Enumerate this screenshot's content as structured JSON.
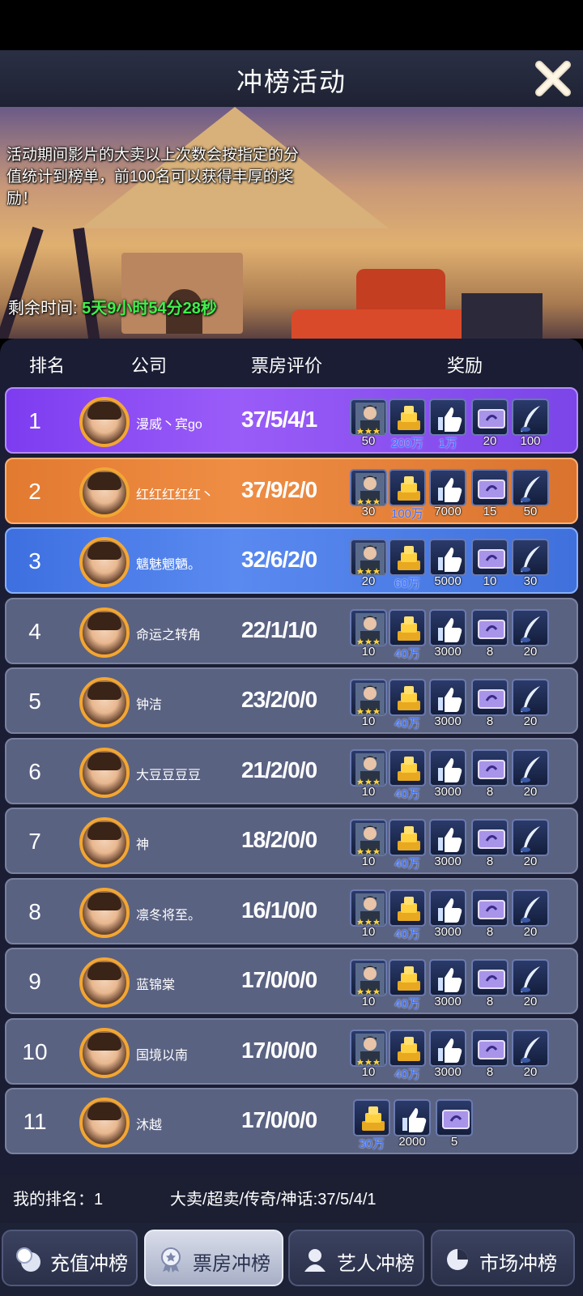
{
  "title": "冲榜活动",
  "banner": {
    "description": "活动期间影片的大卖以上次数会按指定的分值统计到榜单，前100名可以获得丰厚的奖励！",
    "timer_label": "剩余时间:",
    "timer_value": "5天9小时54分28秒"
  },
  "columns": {
    "rank": "排名",
    "company": "公司",
    "score": "票房评价",
    "reward": "奖励"
  },
  "rows": [
    {
      "rank": "1",
      "company": "漫威丶宾go",
      "score": "37/5/4/1",
      "rewards": [
        "50",
        "200万",
        "1万",
        "20",
        "100"
      ]
    },
    {
      "rank": "2",
      "company": "红红红红红丶",
      "score": "37/9/2/0",
      "rewards": [
        "30",
        "100万",
        "7000",
        "15",
        "50"
      ]
    },
    {
      "rank": "3",
      "company": "魑魅魍魉。",
      "score": "32/6/2/0",
      "rewards": [
        "20",
        "60万",
        "5000",
        "10",
        "30"
      ]
    },
    {
      "rank": "4",
      "company": "命运之转角",
      "score": "22/1/1/0",
      "rewards": [
        "10",
        "40万",
        "3000",
        "8",
        "20"
      ]
    },
    {
      "rank": "5",
      "company": "钟洁",
      "score": "23/2/0/0",
      "rewards": [
        "10",
        "40万",
        "3000",
        "8",
        "20"
      ]
    },
    {
      "rank": "6",
      "company": "大豆豆豆豆",
      "score": "21/2/0/0",
      "rewards": [
        "10",
        "40万",
        "3000",
        "8",
        "20"
      ]
    },
    {
      "rank": "7",
      "company": "神",
      "score": "18/2/0/0",
      "rewards": [
        "10",
        "40万",
        "3000",
        "8",
        "20"
      ]
    },
    {
      "rank": "8",
      "company": "凛冬将至。",
      "score": "16/1/0/0",
      "rewards": [
        "10",
        "40万",
        "3000",
        "8",
        "20"
      ]
    },
    {
      "rank": "9",
      "company": "蓝锦棠",
      "score": "17/0/0/0",
      "rewards": [
        "10",
        "40万",
        "3000",
        "8",
        "20"
      ]
    },
    {
      "rank": "10",
      "company": "国境以南",
      "score": "17/0/0/0",
      "rewards": [
        "10",
        "40万",
        "3000",
        "8",
        "20"
      ]
    },
    {
      "rank": "11",
      "company": "沐越",
      "score": "17/0/0/0",
      "rewards": [
        "30万",
        "2000",
        "5"
      ]
    }
  ],
  "my_rank": {
    "label": "我的排名：",
    "value": "1"
  },
  "my_stats": "大卖/超卖/传奇/神话:37/5/4/1",
  "tabs": [
    {
      "label": "充值冲榜",
      "icon": "coins-icon"
    },
    {
      "label": "票房冲榜",
      "icon": "medal-icon"
    },
    {
      "label": "艺人冲榜",
      "icon": "person-icon"
    },
    {
      "label": "市场冲榜",
      "icon": "pie-chart-icon"
    }
  ],
  "active_tab": 1
}
